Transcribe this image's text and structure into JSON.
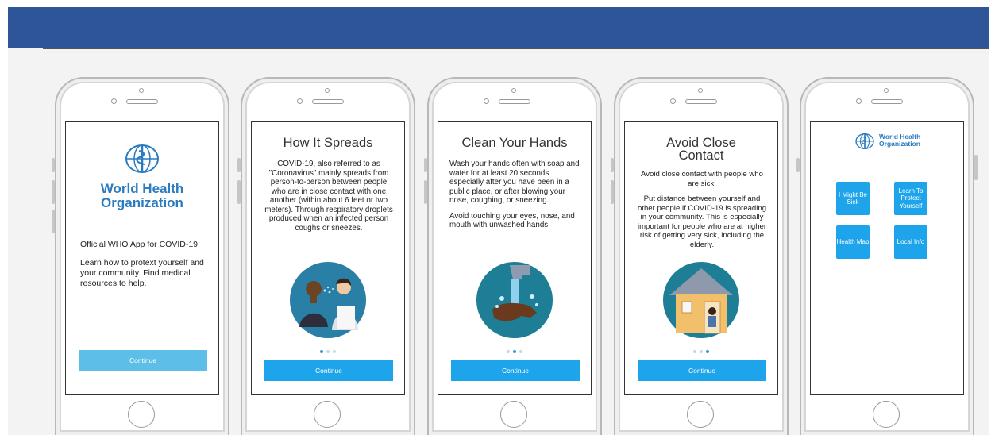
{
  "phones": [
    {
      "logo_name_line1": "World Health",
      "logo_name_line2": "Organization",
      "intro_title": "Official WHO App for COVID-19",
      "intro_body": "Learn how to protext yourself and your community. Find medical resources to help.",
      "continue_label": "Continue"
    },
    {
      "title": "How It Spreads",
      "body": "COVID-19, also referred to as \"Coronavirus\" mainly spreads from person-to-person between people who are in close contact with one another (within about 6 feet or two meters). Through respiratory droplets produced when an infected person coughs or sneezes.",
      "continue_label": "Continue"
    },
    {
      "title": "Clean Your Hands",
      "body_1": "Wash your hands often with soap and water for at least 20 seconds especially after you have been in a public place, or after blowing your nose, coughing, or sneezing.",
      "body_2": "Avoid touching your eyes, nose, and mouth with unwashed hands.",
      "continue_label": "Continue"
    },
    {
      "title_line1": "Avoid Close",
      "title_line2": "Contact",
      "body_1": "Avoid close contact with people who are sick.",
      "body_2": "Put distance between yourself and other people if COVID-19 is spreading in your community. This is especially important for people who are at higher risk of getting very sick, including the elderly.",
      "continue_label": "Continue"
    },
    {
      "logo_name_line1": "World Health",
      "logo_name_line2": "Organization",
      "tiles": [
        "I Might Be Sick",
        "Learn To Protect Yourself",
        "Health Map",
        "Local Info"
      ]
    }
  ],
  "colors": {
    "header_bar": "#2e5597",
    "button": "#1ea4ea",
    "who_blue": "#2b7bc1"
  }
}
